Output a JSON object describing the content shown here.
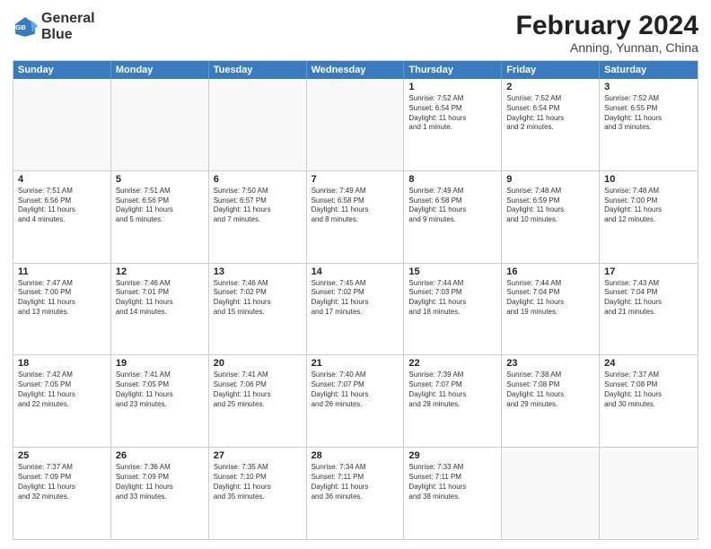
{
  "logo": {
    "line1": "General",
    "line2": "Blue"
  },
  "title": "February 2024",
  "subtitle": "Anning, Yunnan, China",
  "days": [
    "Sunday",
    "Monday",
    "Tuesday",
    "Wednesday",
    "Thursday",
    "Friday",
    "Saturday"
  ],
  "rows": [
    [
      {
        "day": "",
        "info": ""
      },
      {
        "day": "",
        "info": ""
      },
      {
        "day": "",
        "info": ""
      },
      {
        "day": "",
        "info": ""
      },
      {
        "day": "1",
        "info": "Sunrise: 7:52 AM\nSunset: 6:54 PM\nDaylight: 11 hours\nand 1 minute."
      },
      {
        "day": "2",
        "info": "Sunrise: 7:52 AM\nSunset: 6:54 PM\nDaylight: 11 hours\nand 2 minutes."
      },
      {
        "day": "3",
        "info": "Sunrise: 7:52 AM\nSunset: 6:55 PM\nDaylight: 11 hours\nand 3 minutes."
      }
    ],
    [
      {
        "day": "4",
        "info": "Sunrise: 7:51 AM\nSunset: 6:56 PM\nDaylight: 11 hours\nand 4 minutes."
      },
      {
        "day": "5",
        "info": "Sunrise: 7:51 AM\nSunset: 6:56 PM\nDaylight: 11 hours\nand 5 minutes."
      },
      {
        "day": "6",
        "info": "Sunrise: 7:50 AM\nSunset: 6:57 PM\nDaylight: 11 hours\nand 7 minutes."
      },
      {
        "day": "7",
        "info": "Sunrise: 7:49 AM\nSunset: 6:58 PM\nDaylight: 11 hours\nand 8 minutes."
      },
      {
        "day": "8",
        "info": "Sunrise: 7:49 AM\nSunset: 6:58 PM\nDaylight: 11 hours\nand 9 minutes."
      },
      {
        "day": "9",
        "info": "Sunrise: 7:48 AM\nSunset: 6:59 PM\nDaylight: 11 hours\nand 10 minutes."
      },
      {
        "day": "10",
        "info": "Sunrise: 7:48 AM\nSunset: 7:00 PM\nDaylight: 11 hours\nand 12 minutes."
      }
    ],
    [
      {
        "day": "11",
        "info": "Sunrise: 7:47 AM\nSunset: 7:00 PM\nDaylight: 11 hours\nand 13 minutes."
      },
      {
        "day": "12",
        "info": "Sunrise: 7:46 AM\nSunset: 7:01 PM\nDaylight: 11 hours\nand 14 minutes."
      },
      {
        "day": "13",
        "info": "Sunrise: 7:46 AM\nSunset: 7:02 PM\nDaylight: 11 hours\nand 15 minutes."
      },
      {
        "day": "14",
        "info": "Sunrise: 7:45 AM\nSunset: 7:02 PM\nDaylight: 11 hours\nand 17 minutes."
      },
      {
        "day": "15",
        "info": "Sunrise: 7:44 AM\nSunset: 7:03 PM\nDaylight: 11 hours\nand 18 minutes."
      },
      {
        "day": "16",
        "info": "Sunrise: 7:44 AM\nSunset: 7:04 PM\nDaylight: 11 hours\nand 19 minutes."
      },
      {
        "day": "17",
        "info": "Sunrise: 7:43 AM\nSunset: 7:04 PM\nDaylight: 11 hours\nand 21 minutes."
      }
    ],
    [
      {
        "day": "18",
        "info": "Sunrise: 7:42 AM\nSunset: 7:05 PM\nDaylight: 11 hours\nand 22 minutes."
      },
      {
        "day": "19",
        "info": "Sunrise: 7:41 AM\nSunset: 7:05 PM\nDaylight: 11 hours\nand 23 minutes."
      },
      {
        "day": "20",
        "info": "Sunrise: 7:41 AM\nSunset: 7:06 PM\nDaylight: 11 hours\nand 25 minutes."
      },
      {
        "day": "21",
        "info": "Sunrise: 7:40 AM\nSunset: 7:07 PM\nDaylight: 11 hours\nand 26 minutes."
      },
      {
        "day": "22",
        "info": "Sunrise: 7:39 AM\nSunset: 7:07 PM\nDaylight: 11 hours\nand 28 minutes."
      },
      {
        "day": "23",
        "info": "Sunrise: 7:38 AM\nSunset: 7:08 PM\nDaylight: 11 hours\nand 29 minutes."
      },
      {
        "day": "24",
        "info": "Sunrise: 7:37 AM\nSunset: 7:08 PM\nDaylight: 11 hours\nand 30 minutes."
      }
    ],
    [
      {
        "day": "25",
        "info": "Sunrise: 7:37 AM\nSunset: 7:09 PM\nDaylight: 11 hours\nand 32 minutes."
      },
      {
        "day": "26",
        "info": "Sunrise: 7:36 AM\nSunset: 7:09 PM\nDaylight: 11 hours\nand 33 minutes."
      },
      {
        "day": "27",
        "info": "Sunrise: 7:35 AM\nSunset: 7:10 PM\nDaylight: 11 hours\nand 35 minutes."
      },
      {
        "day": "28",
        "info": "Sunrise: 7:34 AM\nSunset: 7:11 PM\nDaylight: 11 hours\nand 36 minutes."
      },
      {
        "day": "29",
        "info": "Sunrise: 7:33 AM\nSunset: 7:11 PM\nDaylight: 11 hours\nand 38 minutes."
      },
      {
        "day": "",
        "info": ""
      },
      {
        "day": "",
        "info": ""
      }
    ]
  ]
}
